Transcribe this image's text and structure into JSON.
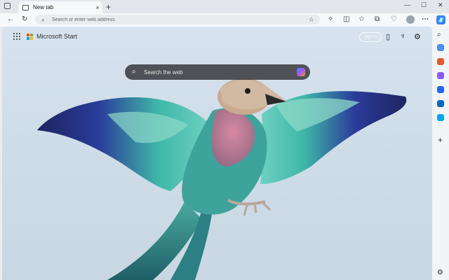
{
  "browser": {
    "tab_title": "New tab",
    "new_tab_symbol": "+",
    "close_tab_symbol": "×",
    "address_placeholder": "Search or enter web address",
    "window": {
      "minimize": "—",
      "maximize": "☐",
      "close": "✕"
    }
  },
  "page": {
    "brand": "Microsoft Start",
    "sign_in": "Sign in",
    "search_placeholder": "Search the web"
  },
  "photo": {
    "subject": "lilac-breasted-roller"
  },
  "colors": {
    "accent": "#1a73e8",
    "ms_red": "#f25022",
    "ms_green": "#7fba00",
    "ms_blue": "#00a4ef",
    "ms_yellow": "#ffb900"
  }
}
